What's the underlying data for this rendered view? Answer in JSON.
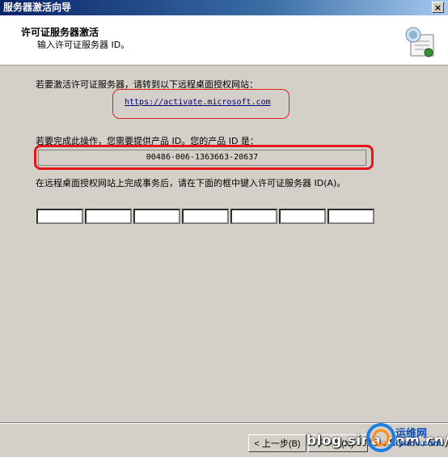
{
  "window": {
    "title": "服务器激活向导",
    "close_glyph": "×"
  },
  "header": {
    "title": "许可证服务器激活",
    "subtitle": "输入许可证服务器 ID。",
    "icon": "certificate-icon"
  },
  "content": {
    "instruction_1": "若要激活许可证服务器，请转到以下远程桌面授权网站：",
    "activation_url": "https://activate.microsoft.com",
    "instruction_2": "若要完成此操作，您需要提供产品 ID。您的产品 ID 是：",
    "product_id": "00486-006-1363663-20637",
    "instruction_3": "在远程桌面授权网站上完成事务后，请在下面的框中键入许可证服务器 ID(A)。",
    "license_id_segments": [
      "",
      "",
      "",
      "",
      "",
      "",
      ""
    ]
  },
  "buttons": {
    "back": "< 上一步(B)",
    "next": "下一步(N) >"
  },
  "watermark": {
    "text": "blog.sina.com.cn/up",
    "logo_text": "运维网",
    "logo_sub": "iyunv.com"
  },
  "colors": {
    "titlebar": "#0a246a",
    "dialog_bg": "#d4d0c8",
    "highlight": "#e5151a",
    "link": "#00007f"
  }
}
